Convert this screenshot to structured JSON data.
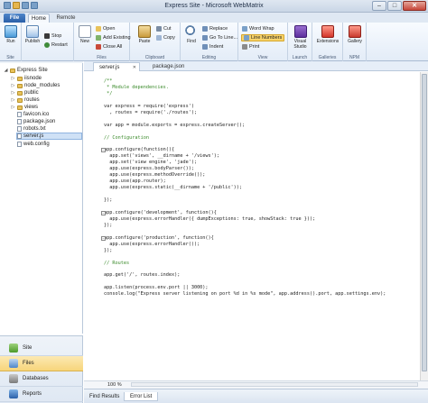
{
  "window": {
    "title": "Express Site - Microsoft WebMatrix",
    "controls": [
      "–",
      "□",
      "✕"
    ]
  },
  "ribbon_tabs": [
    "File",
    "Home",
    "Remote"
  ],
  "ribbon": {
    "site": {
      "run": "Run",
      "label": "Site"
    },
    "publish": {
      "publish": "Publish",
      "stop": "Stop",
      "restart": "Restart"
    },
    "files": {
      "new": "New",
      "open": "Open",
      "add_existing": "Add Existing",
      "close_all": "Close All",
      "label": "Files"
    },
    "clipboard": {
      "paste": "Paste",
      "cut": "Cut",
      "copy": "Copy",
      "label": "Clipboard"
    },
    "editing": {
      "find": "Find",
      "replace": "Replace",
      "goto_line": "Go To Line...",
      "indent": "Indent",
      "label": "Editing"
    },
    "view": {
      "word_wrap": "Word Wrap",
      "line_numbers": "Line Numbers",
      "print": "Print",
      "label": "View"
    },
    "launch": {
      "visual_studio": "Visual Studio",
      "label": "Launch"
    },
    "galleries": {
      "extensions": "Extensions",
      "label": "Galleries"
    },
    "npm": {
      "gallery": "Gallery",
      "label": "NPM"
    }
  },
  "tree": {
    "root": "Express Site",
    "items": [
      "iisnode",
      "node_modules",
      "public",
      "routes",
      "views",
      "favicon.ico",
      "package.json",
      "robots.txt",
      "server.js",
      "web.config"
    ]
  },
  "leftnav": [
    "Site",
    "Files",
    "Databases",
    "Reports"
  ],
  "editor_tabs": [
    "server.js",
    "package.json"
  ],
  "code_lines": [
    "/**",
    " * Module dependencies.",
    " */",
    "",
    "var express = require('express')",
    "  , routes = require('./routes');",
    "",
    "var app = module.exports = express.createServer();",
    "",
    "// Configuration",
    "",
    "app.configure(function(){",
    "  app.set('views', __dirname + '/views');",
    "  app.set('view engine', 'jade');",
    "  app.use(express.bodyParser());",
    "  app.use(express.methodOverride());",
    "  app.use(app.router);",
    "  app.use(express.static(__dirname + '/public'));",
    "",
    "});",
    "",
    "app.configure('development', function(){",
    "  app.use(express.errorHandler({ dumpExceptions: true, showStack: true }));",
    "});",
    "",
    "app.configure('production', function(){",
    "  app.use(express.errorHandler());",
    "});",
    "",
    "// Routes",
    "",
    "app.get('/', routes.index);",
    "",
    "app.listen(process.env.port || 3000);",
    "console.log(\"Express server listening on port %d in %s mode\", app.address().port, app.settings.env);"
  ],
  "status": {
    "zoom": "100 %"
  },
  "bottom_tabs": [
    "Find Results",
    "Error List"
  ]
}
